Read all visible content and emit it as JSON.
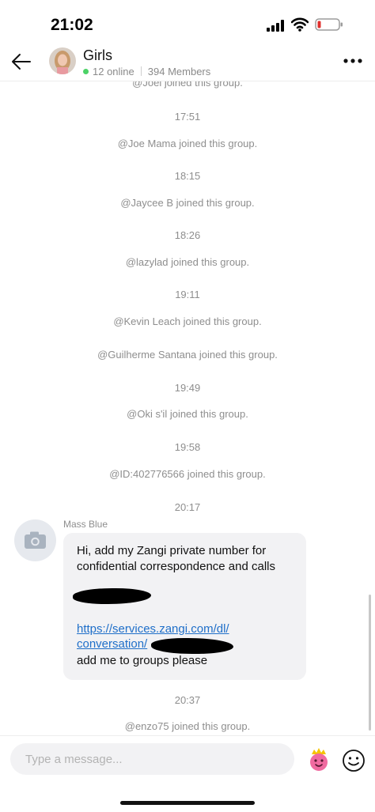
{
  "status_bar": {
    "time": "21:02",
    "battery_color": "#e0302d"
  },
  "header": {
    "title": "Girls",
    "online_text": "12 online",
    "members_text": "394 Members",
    "online_color": "#4cd267"
  },
  "chat": {
    "partial_top_event": "@Joel  joined this group.",
    "events": [
      {
        "time": "17:51",
        "text": "@Joe Mama joined this group."
      },
      {
        "time": "18:15",
        "text": "@Jaycee B joined this group."
      },
      {
        "time": "18:26",
        "text": "@lazylad joined this group."
      },
      {
        "time": "19:11",
        "text": "@Kevin Leach joined this group."
      },
      {
        "time": "",
        "text": "@Guilherme Santana joined this group."
      },
      {
        "time": "19:49",
        "text": "@Oki s'il joined this group."
      },
      {
        "time": "19:58",
        "text": "@ID:402776566 joined this group."
      }
    ],
    "message": {
      "time": "20:17",
      "sender": "Mass Blue",
      "text": "Hi, add my Zangi private number for confidential correspondence and calls",
      "link_line1": "https://services.zangi.com/dl/",
      "link_line2": "conversation/",
      "tail": "add me to groups please"
    },
    "last_event": {
      "time": "20:37",
      "text": "@enzo75 joined this group."
    }
  },
  "input": {
    "placeholder": "Type a message..."
  },
  "colors": {
    "link": "#1f6fc9",
    "system_text": "#8e8e8e",
    "bubble": "#f2f2f4"
  }
}
